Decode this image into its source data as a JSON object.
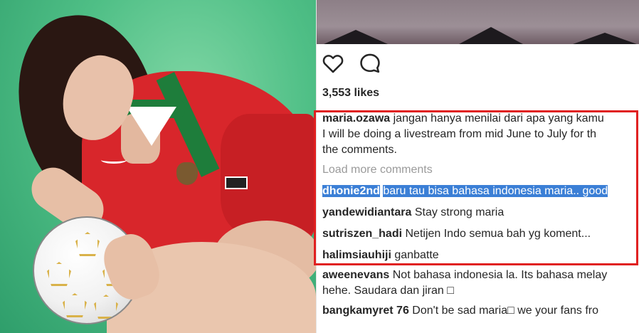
{
  "post": {
    "likes": "3,553 likes"
  },
  "icons": {
    "like": "heart-icon",
    "comment": "comment-bubble-icon"
  },
  "colors": {
    "highlight_border": "#e02020",
    "selection": "#3b7fd6",
    "muted_text": "#9a9a9a"
  },
  "caption": {
    "user": "maria.ozawa",
    "text_line1": "jangan hanya menilai dari apa yang kamu",
    "text_line2": "I will be doing a livestream from mid June to July for th",
    "text_line3": "the comments."
  },
  "load_more": "Load more comments",
  "comments": [
    {
      "user": "dhonie2nd",
      "text": "baru tau bisa bahasa indonesia maria.. good"
    },
    {
      "user": "yandewidiantara",
      "text": "Stay strong maria"
    },
    {
      "user": "sutriszen_hadi",
      "text": "Netijen Indo semua bah yg koment..."
    },
    {
      "user": "halimsiauhiji",
      "text": "ganbatte"
    },
    {
      "user": "aweenevans",
      "text": "Not bahasa indonesia la. Its bahasa melay",
      "text2": "hehe. Saudara dan jiran □"
    },
    {
      "user": "bangkamyret 76",
      "text": "Don't be sad maria□  we your fans fro"
    }
  ]
}
